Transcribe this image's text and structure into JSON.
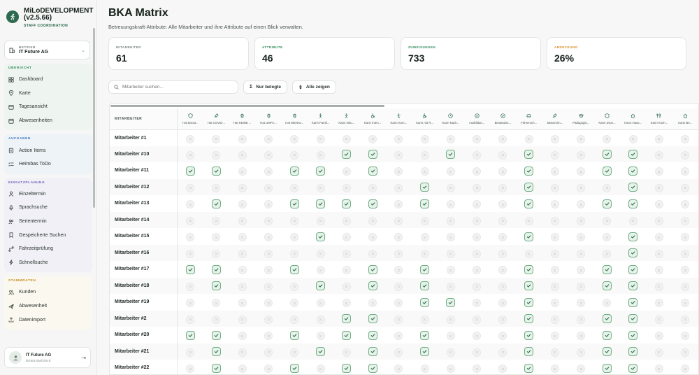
{
  "brand": {
    "name_line1": "MiLoDEVELOPMENT",
    "name_line2": "(v2.5.66)",
    "subtitle": "STAFF COORDINATION"
  },
  "betrieb": {
    "label": "BETRIEB",
    "value": "IT Future AG"
  },
  "nav": [
    {
      "title": "ÜBERSICHT",
      "items": [
        {
          "label": "Dashboard",
          "icon": "grid-icon"
        },
        {
          "label": "Karte",
          "icon": "map-pin-icon"
        },
        {
          "label": "Tagesansicht",
          "icon": "calendar-day-icon"
        },
        {
          "label": "Abwesenheiten",
          "icon": "calendar-icon"
        }
      ]
    },
    {
      "title": "AUFGABEN",
      "items": [
        {
          "label": "Action Items",
          "icon": "clipboard-icon"
        },
        {
          "label": "Heimbas ToDo",
          "icon": "list-icon"
        }
      ]
    },
    {
      "title": "EINSATZPLANUNG",
      "items": [
        {
          "label": "Einzeltermin",
          "icon": "user-icon"
        },
        {
          "label": "Sprachsuche",
          "icon": "mic-icon"
        },
        {
          "label": "Serientermin",
          "icon": "users-icon"
        },
        {
          "label": "Gespeicherte Suchen",
          "icon": "bookmark-icon"
        },
        {
          "label": "Fahrzeitprüfung",
          "icon": "route-icon"
        },
        {
          "label": "Schnellsuche",
          "icon": "bolt-icon"
        }
      ]
    },
    {
      "title": "STAMMDATEN",
      "items": [
        {
          "label": "Kunden",
          "icon": "people-icon"
        },
        {
          "label": "Abwesenheit",
          "icon": "plane-icon"
        },
        {
          "label": "Datenimport",
          "icon": "upload-icon"
        }
      ]
    }
  ],
  "user": {
    "name": "IT Future AG",
    "role": "DEBUGMODUS"
  },
  "page": {
    "title": "BKA Matrix",
    "subtitle": "Betreuungskraft-Attribute: Alle Mitarbeiter und ihre Attribute auf einen Blick verwalten."
  },
  "stats": [
    {
      "label": "MITARBEITER",
      "value": "61",
      "color": "#7a857f"
    },
    {
      "label": "ATTRIBUTE",
      "value": "46",
      "color": "#2d8a5a"
    },
    {
      "label": "ZUWEISUNGEN",
      "value": "733",
      "color": "#2d8a5a"
    },
    {
      "label": "ABDECKUNG",
      "value": "26%",
      "color": "#d98b1c"
    }
  ],
  "toolbar": {
    "search_placeholder": "Mitarbeiter suchen...",
    "filter_label": "Nur belegte",
    "show_all_label": "Alle zeigen"
  },
  "table": {
    "corner_label": "MITARBEITER",
    "attributes": [
      "Hat Boost...",
      "Hat COVID...",
      "Hat KEINE ...",
      "Hat UMFA...",
      "Hat WENIG...",
      "Kann Famil...",
      "Kann Inku...",
      "Kann Inten...",
      "Kann Kom...",
      "Kann mit R...",
      "Kann Nach...",
      "Ausbildun...",
      "Bestandsc...",
      "Führersch...",
      "Masernim...",
      "Pädagogis...",
      "Kann Drun...",
      "Kann Haus...",
      "Kann Koch...",
      "Kann Be..."
    ],
    "rows": [
      {
        "name": "Mitarbeiter #1",
        "checks": [
          0,
          0,
          0,
          0,
          0,
          0,
          0,
          0,
          0,
          0,
          0,
          0,
          0,
          0,
          0,
          0,
          0,
          0,
          0,
          0
        ]
      },
      {
        "name": "Mitarbeiter #10",
        "checks": [
          0,
          0,
          0,
          0,
          0,
          0,
          1,
          1,
          0,
          0,
          1,
          0,
          0,
          1,
          0,
          0,
          1,
          1,
          0,
          0
        ]
      },
      {
        "name": "Mitarbeiter #11",
        "checks": [
          1,
          1,
          0,
          0,
          1,
          1,
          0,
          1,
          0,
          0,
          0,
          0,
          0,
          1,
          0,
          0,
          1,
          1,
          0,
          0
        ]
      },
      {
        "name": "Mitarbeiter #12",
        "checks": [
          0,
          0,
          0,
          0,
          0,
          0,
          0,
          0,
          0,
          1,
          0,
          0,
          0,
          1,
          0,
          0,
          0,
          1,
          0,
          0
        ]
      },
      {
        "name": "Mitarbeiter #13",
        "checks": [
          0,
          1,
          0,
          0,
          1,
          1,
          1,
          1,
          0,
          1,
          0,
          0,
          0,
          1,
          0,
          0,
          1,
          1,
          0,
          0
        ]
      },
      {
        "name": "Mitarbeiter #14",
        "checks": [
          0,
          0,
          0,
          0,
          0,
          0,
          0,
          0,
          0,
          0,
          0,
          0,
          0,
          0,
          0,
          0,
          0,
          0,
          0,
          0
        ]
      },
      {
        "name": "Mitarbeiter #15",
        "checks": [
          0,
          0,
          0,
          0,
          0,
          1,
          0,
          0,
          0,
          0,
          0,
          0,
          0,
          1,
          0,
          0,
          0,
          1,
          0,
          0
        ]
      },
      {
        "name": "Mitarbeiter #16",
        "checks": [
          0,
          0,
          0,
          0,
          0,
          0,
          0,
          0,
          0,
          0,
          0,
          0,
          0,
          0,
          0,
          0,
          0,
          1,
          0,
          0
        ]
      },
      {
        "name": "Mitarbeiter #17",
        "checks": [
          1,
          1,
          0,
          0,
          1,
          0,
          0,
          1,
          0,
          1,
          0,
          0,
          0,
          1,
          0,
          0,
          1,
          1,
          0,
          0
        ]
      },
      {
        "name": "Mitarbeiter #18",
        "checks": [
          0,
          1,
          0,
          0,
          0,
          1,
          0,
          1,
          0,
          1,
          0,
          0,
          0,
          1,
          0,
          0,
          1,
          1,
          0,
          0
        ]
      },
      {
        "name": "Mitarbeiter #19",
        "checks": [
          0,
          0,
          0,
          0,
          0,
          0,
          0,
          0,
          0,
          1,
          1,
          0,
          0,
          1,
          0,
          0,
          0,
          1,
          0,
          0
        ]
      },
      {
        "name": "Mitarbeiter #2",
        "checks": [
          0,
          0,
          0,
          0,
          0,
          0,
          1,
          1,
          0,
          0,
          0,
          0,
          0,
          1,
          0,
          0,
          1,
          1,
          0,
          0
        ]
      },
      {
        "name": "Mitarbeiter #20",
        "checks": [
          1,
          1,
          0,
          0,
          1,
          0,
          1,
          1,
          0,
          1,
          0,
          0,
          0,
          1,
          0,
          0,
          1,
          1,
          0,
          0
        ]
      },
      {
        "name": "Mitarbeiter #21",
        "checks": [
          0,
          1,
          0,
          0,
          0,
          1,
          0,
          1,
          0,
          1,
          0,
          0,
          0,
          1,
          0,
          0,
          1,
          1,
          0,
          0
        ]
      },
      {
        "name": "Mitarbeiter #22",
        "checks": [
          0,
          1,
          0,
          0,
          1,
          0,
          1,
          1,
          0,
          0,
          0,
          0,
          0,
          1,
          0,
          0,
          1,
          1,
          0,
          0
        ]
      }
    ]
  }
}
